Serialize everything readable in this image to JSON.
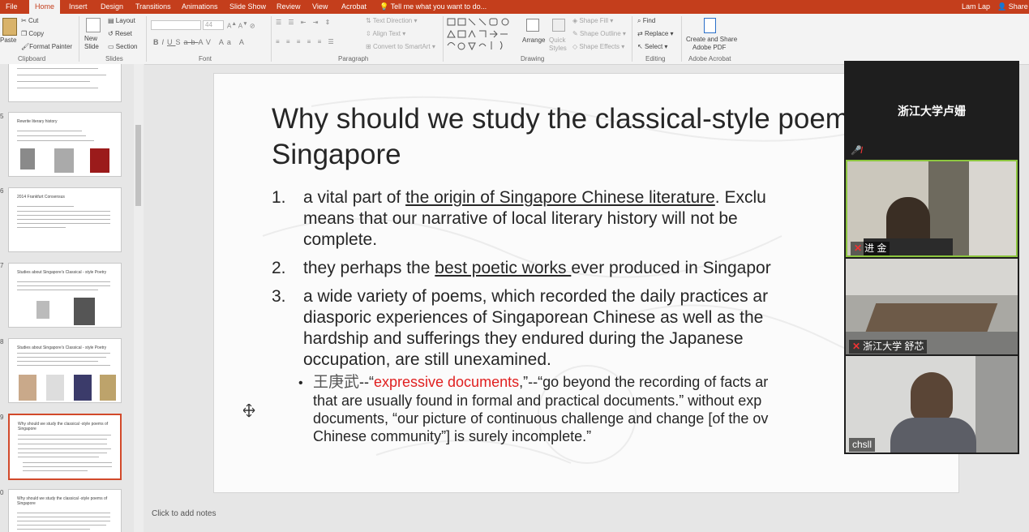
{
  "tabs": [
    "File",
    "Home",
    "Insert",
    "Design",
    "Transitions",
    "Animations",
    "Slide Show",
    "Review",
    "View",
    "Acrobat"
  ],
  "tell_me": "Tell me what you want to do...",
  "user_name": "Lam Lap",
  "share_label": "Share",
  "ribbon": {
    "clipboard": {
      "paste": "Paste",
      "cut": "Cut",
      "copy": "Copy",
      "format_painter": "Format Painter",
      "label": "Clipboard"
    },
    "slides": {
      "new_slide": "New Slide",
      "layout": "Layout",
      "reset": "Reset",
      "section": "Section",
      "label": "Slides"
    },
    "font": {
      "font_size": "44",
      "label": "Font"
    },
    "paragraph": {
      "text_direction": "Text Direction",
      "align_text": "Align Text",
      "convert_smartart": "Convert to SmartArt",
      "label": "Paragraph"
    },
    "drawing": {
      "arrange": "Arrange",
      "quick_styles": "Quick Styles",
      "shape_fill": "Shape Fill",
      "shape_outline": "Shape Outline",
      "shape_effects": "Shape Effects",
      "label": "Drawing"
    },
    "editing": {
      "find": "Find",
      "replace": "Replace",
      "select": "Select",
      "label": "Editing"
    },
    "acrobat": {
      "create_share": "Create and Share",
      "adobe_pdf": "Adobe PDF",
      "label": "Adobe Acrobat"
    }
  },
  "thumbnails": [
    {
      "num": "5",
      "title": "Rewrite literary history"
    },
    {
      "num": "6",
      "title": "2014 Frankfurt Consensus"
    },
    {
      "num": "7",
      "title": "Studies about Singapore's Classical - style Poetry"
    },
    {
      "num": "8",
      "title": "Studies about Singapore's Classical - style Poetry"
    },
    {
      "num": "9",
      "title": "Why should we study the classical -style poems of Singapore"
    },
    {
      "num": "0",
      "title": "Why should we study the classical -style poems of Singapore"
    }
  ],
  "slide": {
    "title": "Why should we study the classical-style poems of Singapore",
    "p1": {
      "num": "1.",
      "a": "a vital part of ",
      "u": "the origin of Singapore Chinese literature",
      "b": ". Exclu",
      "line2": "means that our narrative of local literary history will not be",
      "line3": "complete."
    },
    "p2": {
      "num": "2.",
      "a": "they perhaps the ",
      "u": "best poetic works ",
      "b": "ever produced in Singapor"
    },
    "p3": {
      "num": "3.",
      "line1": "a wide variety of poems, which recorded the daily practices ar",
      "line2": "diasporic experiences of Singaporean Chinese as well as the",
      "line3": "hardship and sufferings they endured during the Japanese",
      "line4": "occupation, are still unexamined."
    },
    "sub": {
      "bullet": "•",
      "name": "王庚武",
      "dash": "--“",
      "red": "expressive documents",
      "rest1": ",”--“go beyond the recording of facts ar",
      "line2": "that are usually found in formal and practical documents.” without exp",
      "line3": "documents, “our picture of continuous challenge and change [of the ov",
      "line4": "Chinese community”] is surely incomplete.”"
    }
  },
  "notes_placeholder": "Click to add notes",
  "video": {
    "header_name": "浙江大学卢姗",
    "participants": [
      "进 金",
      "浙江大学 舒芯",
      "chsll"
    ]
  }
}
